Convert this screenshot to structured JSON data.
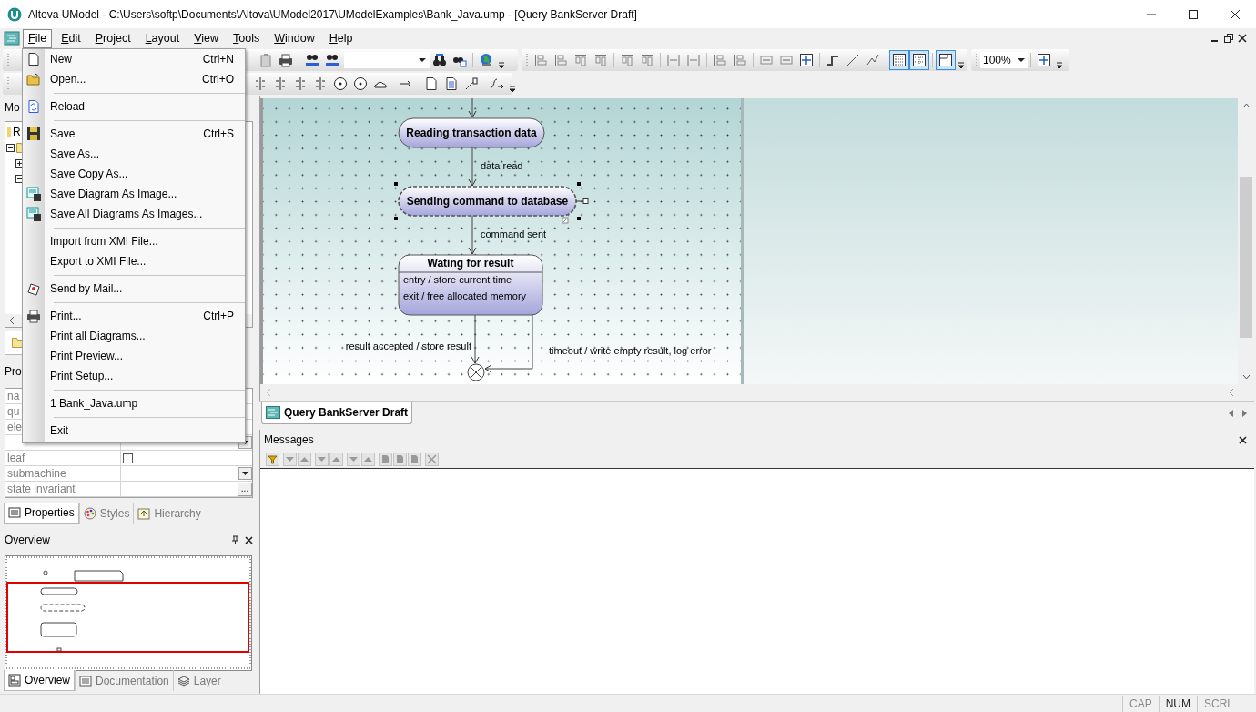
{
  "window": {
    "title": "Altova UModel - C:\\Users\\softp\\Documents\\Altova\\UModel2017\\UModelExamples\\Bank_Java.ump - [Query BankServer Draft]"
  },
  "menu_bar": [
    {
      "label": "File",
      "selected": true
    },
    {
      "label": "Edit",
      "selected": false
    },
    {
      "label": "Project",
      "selected": false
    },
    {
      "label": "Layout",
      "selected": false
    },
    {
      "label": "View",
      "selected": false
    },
    {
      "label": "Tools",
      "selected": false
    },
    {
      "label": "Window",
      "selected": false
    },
    {
      "label": "Help",
      "selected": false
    }
  ],
  "file_menu": {
    "groups": [
      [
        {
          "label": "New",
          "shortcut": "Ctrl+N"
        },
        {
          "label": "Open...",
          "shortcut": "Ctrl+O"
        }
      ],
      [
        {
          "label": "Reload"
        }
      ],
      [
        {
          "label": "Save",
          "shortcut": "Ctrl+S"
        },
        {
          "label": "Save As..."
        },
        {
          "label": "Save Copy As..."
        },
        {
          "label": "Save Diagram As Image..."
        },
        {
          "label": "Save All Diagrams As Images..."
        }
      ],
      [
        {
          "label": "Import from XMI File..."
        },
        {
          "label": "Export to XMI File..."
        }
      ],
      [
        {
          "label": "Send by Mail..."
        }
      ],
      [
        {
          "label": "Print...",
          "shortcut": "Ctrl+P"
        },
        {
          "label": "Print all Diagrams..."
        },
        {
          "label": "Print Preview..."
        },
        {
          "label": "Print Setup..."
        }
      ],
      [
        {
          "label": "1 Bank_Java.ump"
        }
      ],
      [
        {
          "label": "Exit"
        }
      ]
    ]
  },
  "toolbar": {
    "zoom": "100%",
    "toggle_buttons": [
      {
        "on": true
      },
      {
        "on": true
      },
      {
        "on": true
      }
    ]
  },
  "model_tree": {
    "title": "Mo",
    "root": "R",
    "children": [
      {
        "expanded": true,
        "children": [
          {
            "expanded": false
          },
          {
            "expanded": true
          }
        ]
      }
    ]
  },
  "properties": {
    "title": "Pro",
    "rows": [
      {
        "kind": "text",
        "name": "na"
      },
      {
        "kind": "text",
        "name": "qu"
      },
      {
        "kind": "text",
        "name": "ele"
      },
      {
        "kind": "dropdown"
      },
      {
        "kind": "checkbox",
        "name": "leaf",
        "checked": false
      },
      {
        "kind": "dropdown",
        "name": "submachine"
      },
      {
        "kind": "ellipsis",
        "name": "state invariant",
        "button": "..."
      }
    ],
    "tabs": [
      {
        "label": "Properties",
        "selected": true
      },
      {
        "label": "Styles",
        "selected": false
      },
      {
        "label": "Hierarchy",
        "selected": false
      }
    ]
  },
  "overview": {
    "title": "Overview",
    "tabs": [
      {
        "label": "Overview",
        "selected": true
      },
      {
        "label": "Documentation",
        "selected": false
      },
      {
        "label": "Layer",
        "selected": false
      }
    ]
  },
  "diagram": {
    "states": [
      {
        "kind": "simple",
        "name": "Reading transaction data",
        "selected": false
      },
      {
        "kind": "simple",
        "name": "Sending command to database",
        "selected": true
      },
      {
        "kind": "composite",
        "name": "Wating for result",
        "activities": [
          "entry / store current time",
          "exit / free allocated memory"
        ],
        "selected": false
      }
    ],
    "transitions": [
      {
        "label": "data read"
      },
      {
        "label": "command sent"
      },
      {
        "label": "result accepted / store result"
      },
      {
        "label": "timeout / write empty result, log error"
      }
    ]
  },
  "document_tabs": [
    {
      "label": "Query BankServer Draft",
      "selected": true
    }
  ],
  "messages": {
    "title": "Messages"
  },
  "status_bar": [
    {
      "label": "CAP",
      "on": false
    },
    {
      "label": "NUM",
      "on": true
    },
    {
      "label": "SCRL",
      "on": false
    }
  ]
}
